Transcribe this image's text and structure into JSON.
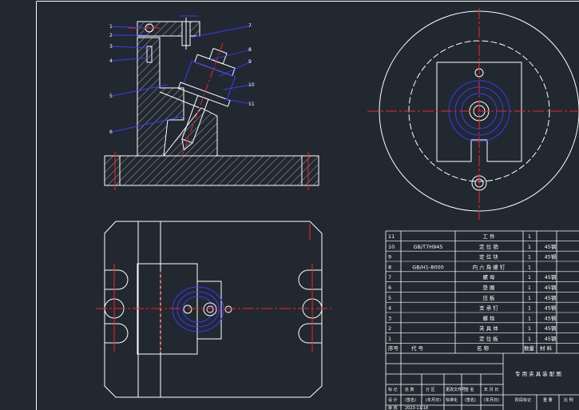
{
  "colors": {
    "background": "#212830",
    "outline": "#ffffff",
    "centerline": "#ff2020",
    "leader": "#3a3aff",
    "hidden": "#ff2020"
  },
  "balloons": [
    "1",
    "2",
    "3",
    "4",
    "5",
    "6",
    "7",
    "8",
    "9",
    "10",
    "11"
  ],
  "bom": {
    "rows": [
      {
        "no": "11",
        "code": "",
        "name": "工 件",
        "qty": "1",
        "material": ""
      },
      {
        "no": "10",
        "code": "GB/T7H945",
        "name": "定 位 销",
        "qty": "1",
        "material": "45钢"
      },
      {
        "no": "9",
        "code": "",
        "name": "定 位 块",
        "qty": "1",
        "material": "45钢"
      },
      {
        "no": "8",
        "code": "GB/H1-8000",
        "name": "内 六 角 螺 钉",
        "qty": "1",
        "material": ""
      },
      {
        "no": "7",
        "code": "",
        "name": "螺 母",
        "qty": "1",
        "material": "45钢"
      },
      {
        "no": "6",
        "code": "",
        "name": "垫 圈",
        "qty": "1",
        "material": "45钢"
      },
      {
        "no": "5",
        "code": "",
        "name": "压 板",
        "qty": "1",
        "material": "45钢"
      },
      {
        "no": "4",
        "code": "",
        "name": "支 承 钉",
        "qty": "1",
        "material": "45钢"
      },
      {
        "no": "3",
        "code": "",
        "name": "螺 栓",
        "qty": "1",
        "material": "45钢"
      },
      {
        "no": "2",
        "code": "",
        "name": "夹 具 体",
        "qty": "1",
        "material": "45钢"
      },
      {
        "no": "1",
        "code": "",
        "name": "定 位 板",
        "qty": "1",
        "material": "45钢"
      }
    ],
    "header": {
      "no": "序号",
      "code": "代 号",
      "name": "名 称",
      "qty": "数量",
      "material": "材 料"
    }
  },
  "title_block": {
    "title": "专 用 夹 具 装 配 图",
    "r1": [
      "标 记",
      "处 数",
      "分 区",
      "更改文件号",
      "签 名",
      "年 月 日"
    ],
    "r2": [
      "设 计",
      "(签名)",
      "(年月日)",
      "标准化",
      "(签名)",
      "(年月日)",
      "阶段标记",
      "重 量",
      "比 例"
    ],
    "r3": [
      "审 核",
      "2023-11-18"
    ]
  }
}
